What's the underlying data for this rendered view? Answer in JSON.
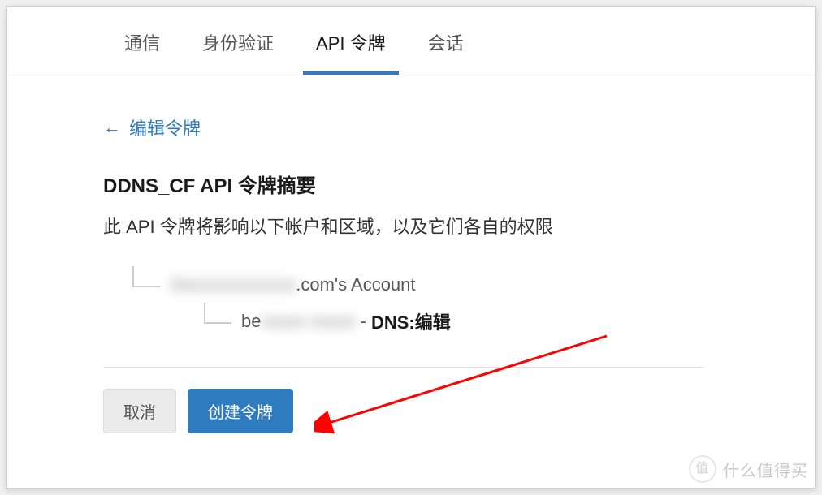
{
  "tabs": {
    "items": [
      {
        "label": "通信",
        "active": false
      },
      {
        "label": "身份验证",
        "active": false
      },
      {
        "label": "API 令牌",
        "active": true
      },
      {
        "label": "会话",
        "active": false
      }
    ]
  },
  "back_link": {
    "arrow": "←",
    "text": "编辑令牌"
  },
  "summary": {
    "title": "DDNS_CF API 令牌摘要",
    "subtitle": "此 API 令牌将影响以下帐户和区域，以及它们各自的权限"
  },
  "tree": {
    "account": {
      "redacted_prefix": "3xxxxxxxxxxxxx",
      "suffix": ".com's Account"
    },
    "zone": {
      "prefix": "be",
      "redacted": "xxxxx xxxxx",
      "separator": " - ",
      "permission": "DNS:编辑"
    }
  },
  "actions": {
    "cancel": "取消",
    "create": "创建令牌"
  },
  "watermark": {
    "logo_text": "值",
    "text": "什么值得买"
  }
}
